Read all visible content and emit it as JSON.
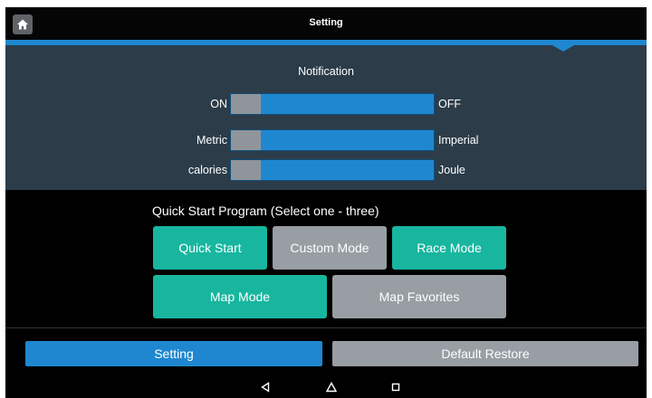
{
  "header": {
    "title": "Setting",
    "home_icon": "home-icon"
  },
  "notification": {
    "title": "Notification",
    "toggles": [
      {
        "left_label": "ON",
        "right_label": "OFF",
        "state": "ON"
      },
      {
        "left_label": "Metric",
        "right_label": "Imperial",
        "state": "Metric"
      },
      {
        "left_label": "calories",
        "right_label": "Joule",
        "state": "calories"
      }
    ]
  },
  "quick_start": {
    "title": "Quick Start Program (Select one - three)",
    "buttons": [
      {
        "label": "Quick Start",
        "selected": true
      },
      {
        "label": "Custom Mode",
        "selected": false
      },
      {
        "label": "Race Mode",
        "selected": true
      },
      {
        "label": "Map Mode",
        "selected": true
      },
      {
        "label": "Map Favorites",
        "selected": false
      }
    ]
  },
  "footer": {
    "setting_label": "Setting",
    "restore_label": "Default Restore"
  },
  "nav": {
    "icons": [
      "back-icon",
      "home-icon",
      "recent-apps-icon"
    ]
  },
  "colors": {
    "accent_blue": "#1f87d0",
    "selected_teal": "#18b69f",
    "unselected_gray": "#989ea3",
    "panel": "#2c3c49"
  }
}
